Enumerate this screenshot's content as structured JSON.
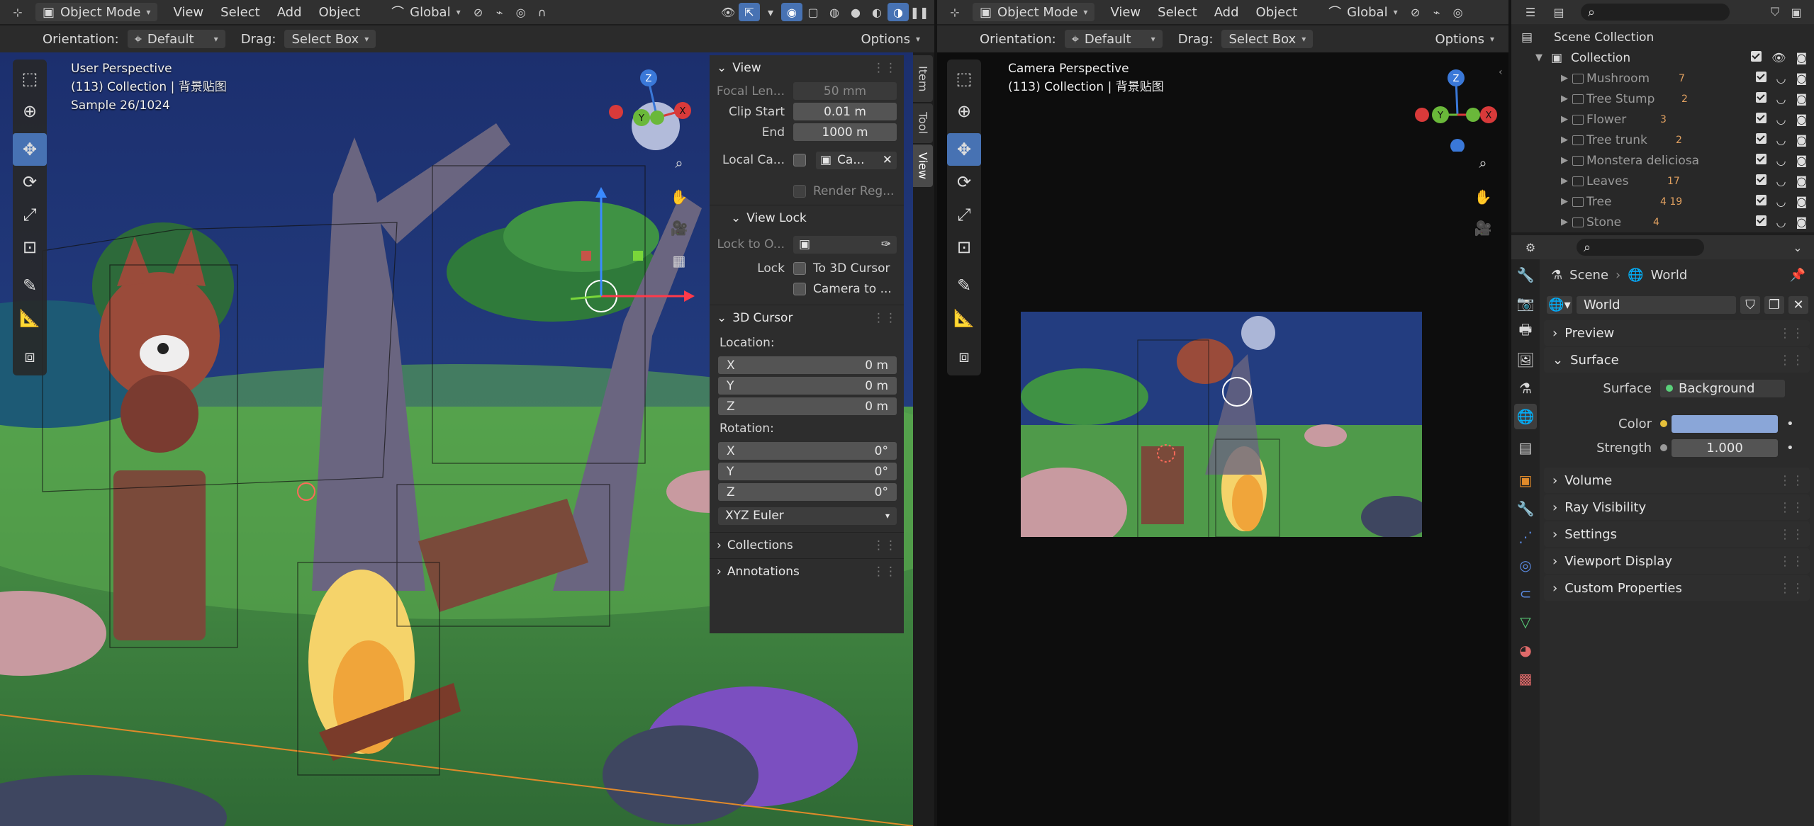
{
  "left_header": {
    "mode": "Object Mode",
    "menus": [
      "View",
      "Select",
      "Add",
      "Object"
    ],
    "transform": "Global"
  },
  "left_subheader": {
    "orientation_label": "Orientation:",
    "orientation_value": "Default",
    "drag_label": "Drag:",
    "drag_value": "Select Box",
    "options": "Options"
  },
  "left_viewport": {
    "line1": "User Perspective",
    "line2": "(113) Collection | 背景贴图",
    "line3": "Sample 26/1024"
  },
  "npanel": {
    "tabs": [
      "Item",
      "Tool",
      "View"
    ],
    "view_header": "View",
    "focal_label": "Focal Len...",
    "focal_value": "50 mm",
    "clip_start_label": "Clip Start",
    "clip_start_value": "0.01 m",
    "end_label": "End",
    "end_value": "1000 m",
    "local_cam_label": "Local Ca...",
    "local_cam_value": "Ca...",
    "render_region": "Render Reg...",
    "view_lock_header": "View Lock",
    "lock_to_label": "Lock to O...",
    "lock_label": "Lock",
    "lock_cursor": "To 3D Cursor",
    "camera_to": "Camera to ...",
    "cursor_header": "3D Cursor",
    "location_label": "Location:",
    "loc_x": "0 m",
    "loc_y": "0 m",
    "loc_z": "0 m",
    "rotation_label": "Rotation:",
    "rot_x": "0°",
    "rot_y": "0°",
    "rot_z": "0°",
    "x": "X",
    "y": "Y",
    "z": "Z",
    "rotation_mode": "XYZ Euler",
    "collections": "Collections",
    "annotations": "Annotations"
  },
  "right_header": {
    "mode": "Object Mode",
    "menus": [
      "View",
      "Select",
      "Add",
      "Object"
    ],
    "transform": "Global"
  },
  "right_subheader": {
    "orientation_label": "Orientation:",
    "orientation_value": "Default",
    "drag_label": "Drag:",
    "drag_value": "Select Box",
    "options": "Options"
  },
  "right_viewport": {
    "line1": "Camera Perspective",
    "line2": "(113) Collection | 背景贴图"
  },
  "gizmo": {
    "x": "X",
    "y": "Y",
    "z": "Z"
  },
  "outliner": {
    "scene_collection": "Scene Collection",
    "collection": "Collection",
    "items": [
      {
        "name": "Mushroom",
        "count": "7"
      },
      {
        "name": "Tree Stump",
        "count": "2"
      },
      {
        "name": "Flower",
        "count": "3"
      },
      {
        "name": "Tree trunk",
        "count": "2"
      },
      {
        "name": "Monstera deliciosa",
        "count": ""
      },
      {
        "name": "Leaves",
        "count": "17"
      },
      {
        "name": "Tree",
        "count": "4 19"
      },
      {
        "name": "Stone",
        "count": "4"
      }
    ]
  },
  "properties": {
    "breadcrumb_scene": "Scene",
    "breadcrumb_world": "World",
    "world_name": "World",
    "preview": "Preview",
    "surface": "Surface",
    "surface_label": "Surface",
    "surface_value": "Background",
    "color_label": "Color",
    "color_value": "#8aa6d8",
    "strength_label": "Strength",
    "strength_value": "1.000",
    "volume": "Volume",
    "ray_visibility": "Ray Visibility",
    "settings": "Settings",
    "viewport_display": "Viewport Display",
    "custom_properties": "Custom Properties"
  }
}
